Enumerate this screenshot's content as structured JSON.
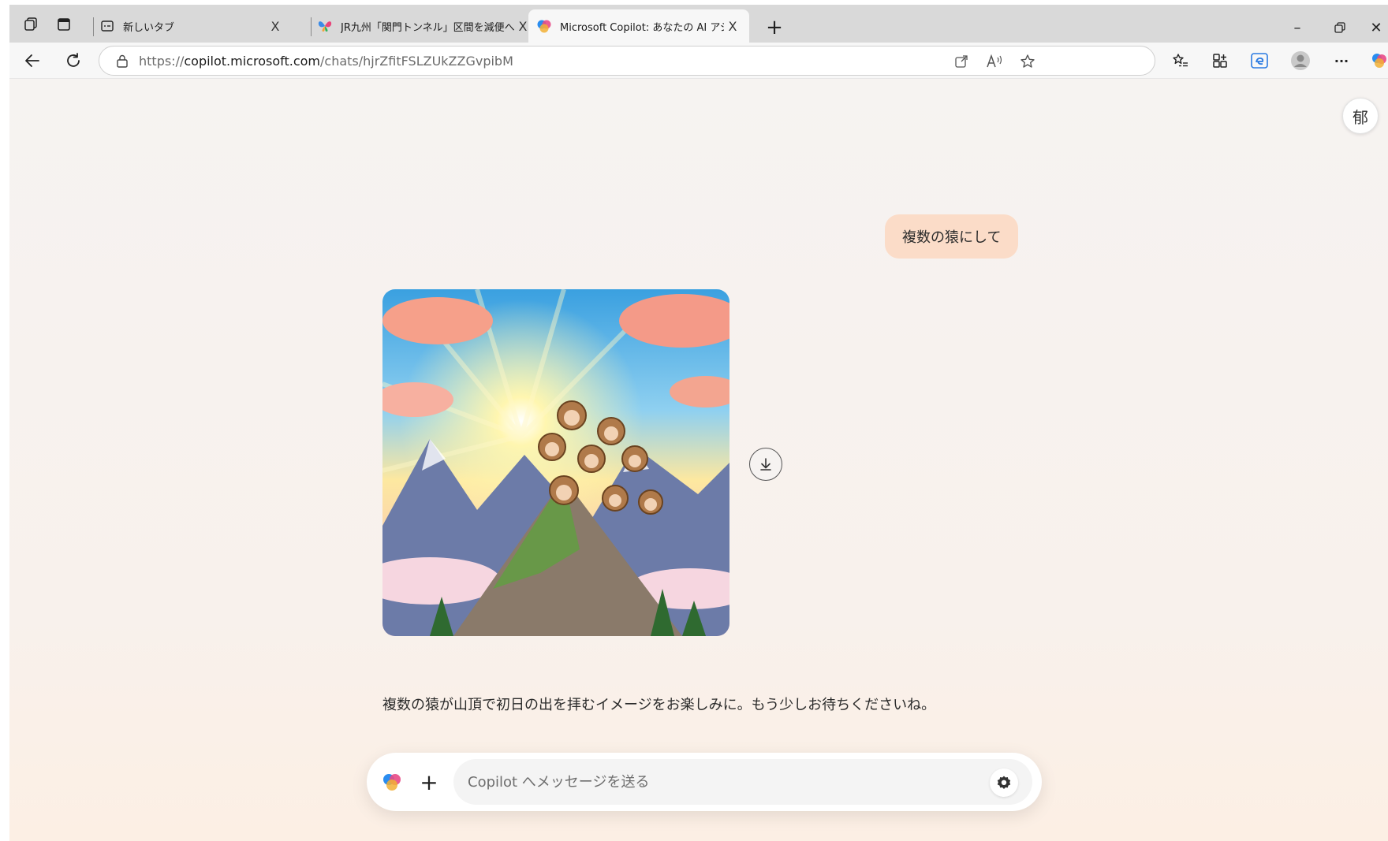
{
  "browser": {
    "tabs": [
      {
        "title": "新しいタブ",
        "close": "X",
        "active": false
      },
      {
        "title": "JR九州「関門トンネル」区間を減便へ",
        "close": "X",
        "active": false
      },
      {
        "title": "Microsoft Copilot: あなたの AI アシ",
        "close": "X",
        "active": true
      }
    ],
    "new_tab_label": "+",
    "window_minimize": "–",
    "window_close": "✕",
    "address": {
      "prefix": "https://",
      "domain": "copilot.microsoft.com",
      "path": "/chats/hjrZfitFSLZUkZZGvpibM"
    },
    "more_label": "···"
  },
  "page": {
    "profile_initial": "郁",
    "user_message": "複数の猿にして",
    "assistant_reply": "複数の猿が山頂で初日の出を拝むイメージをお楽しみに。もう少しお待ちくださいね。",
    "composer": {
      "placeholder": "Copilot へメッセージを送る",
      "plus_label": "+"
    }
  },
  "colors": {
    "user_bubble": "#fbdcc8",
    "page_bg": "#f6f3f1"
  }
}
